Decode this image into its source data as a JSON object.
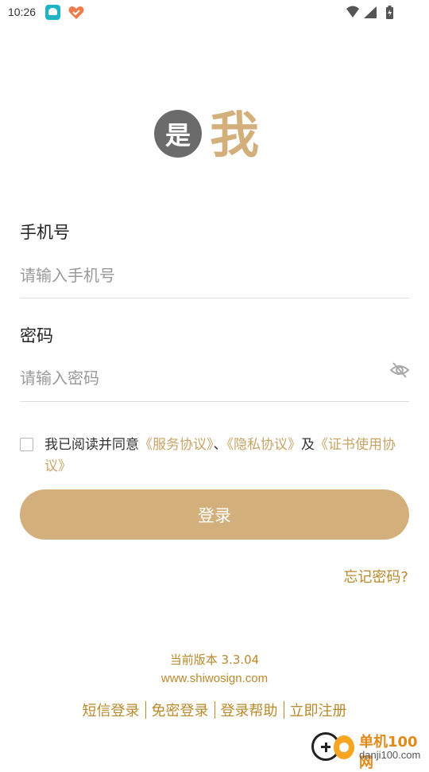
{
  "status_bar": {
    "time": "10:26"
  },
  "logo": {
    "circle_char": "是",
    "char": "我"
  },
  "phone": {
    "label": "手机号",
    "placeholder": "请输入手机号"
  },
  "password": {
    "label": "密码",
    "placeholder": "请输入密码"
  },
  "agreement": {
    "prefix": "我已阅读并同意",
    "service": "《服务协议》",
    "sep": "、",
    "privacy": "《隐私协议》",
    "and": "及",
    "certificate": "《证书使用协议》",
    "checked": false
  },
  "login_button": "登录",
  "forgot_password": "忘记密码?",
  "footer": {
    "version": "当前版本  3.3.04",
    "website": "www.shiwosign.com",
    "links": [
      "短信登录",
      "免密登录",
      "登录帮助",
      "立即注册"
    ]
  },
  "watermark": {
    "name": "单机100网",
    "url": "danji100.com"
  },
  "colors": {
    "accent": "#d3b07b",
    "link": "#b9892d"
  }
}
